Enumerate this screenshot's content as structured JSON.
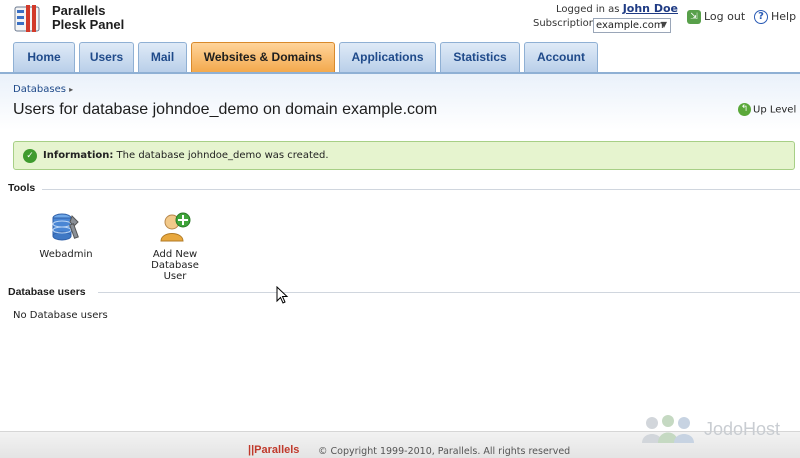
{
  "header": {
    "brand_line1": "Parallels",
    "brand_line2": "Plesk Panel",
    "logged_in_label": "Logged in as",
    "user_name": "John Doe",
    "subscription_label": "Subscription",
    "subscription_value": "example.com",
    "logout_label": "Log out",
    "help_label": "Help"
  },
  "tabs": [
    {
      "label": "Home",
      "active": false
    },
    {
      "label": "Users",
      "active": false
    },
    {
      "label": "Mail",
      "active": false
    },
    {
      "label": "Websites & Domains",
      "active": true
    },
    {
      "label": "Applications",
      "active": false
    },
    {
      "label": "Statistics",
      "active": false
    },
    {
      "label": "Account",
      "active": false
    }
  ],
  "breadcrumb": {
    "item": "Databases"
  },
  "page": {
    "title": "Users for database johndoe_demo on domain example.com",
    "up_level": "Up Level"
  },
  "info": {
    "label": "Information:",
    "text": "The database johndoe_demo was created."
  },
  "tools": {
    "title": "Tools",
    "items": [
      {
        "label": "Webadmin"
      },
      {
        "label_line1": "Add New Database",
        "label_line2": "User"
      }
    ]
  },
  "db_users": {
    "title": "Database users",
    "empty_text": "No Database users"
  },
  "footer": {
    "logo": "||Parallels",
    "copyright": "© Copyright 1999-2010, Parallels. All rights reserved"
  },
  "watermark": {
    "text": "JodoHost"
  },
  "colors": {
    "tab_active": "#f3a94d",
    "tab_inactive": "#c8daef",
    "info_bg": "#e6f4cf",
    "info_border": "#a7cf86",
    "link_blue": "#1f4a8a"
  }
}
